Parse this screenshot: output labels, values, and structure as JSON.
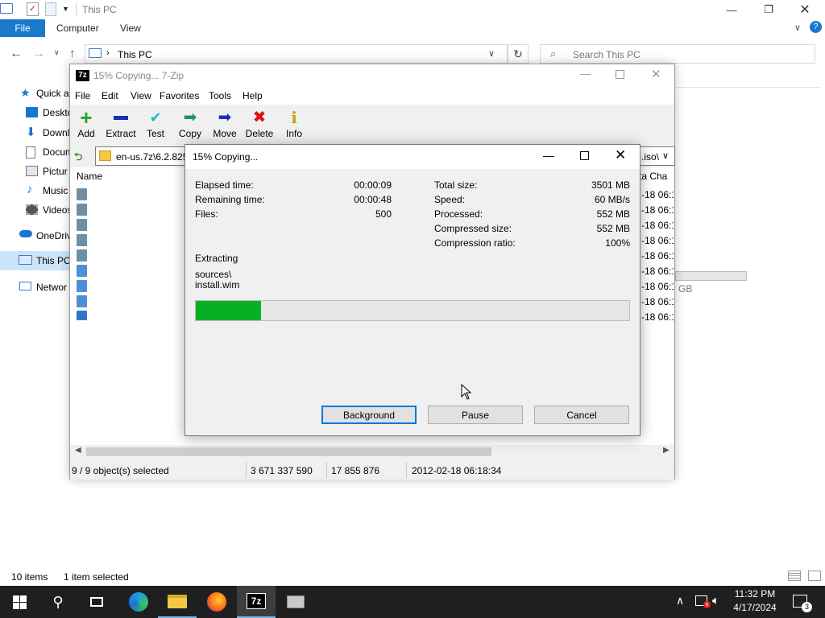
{
  "explorer": {
    "title": "This PC",
    "ribbon": {
      "file": "File",
      "tabs": [
        "Computer",
        "View"
      ]
    },
    "address": "This PC",
    "search_placeholder": "Search This PC",
    "nav": [
      {
        "label": "Quick a"
      },
      {
        "label": "Deskto"
      },
      {
        "label": "Downl"
      },
      {
        "label": "Docum"
      },
      {
        "label": "Pictur"
      },
      {
        "label": "Music"
      },
      {
        "label": "Videos"
      },
      {
        "label": "OneDriv"
      },
      {
        "label": "This PC"
      },
      {
        "label": "Networ"
      }
    ],
    "right_frag": "GB",
    "status_items": "10 items",
    "status_selected": "1 item selected"
  },
  "zip": {
    "title": "15% Copying... 7-Zip",
    "menu": [
      "File",
      "Edit",
      "View",
      "Favorites",
      "Tools",
      "Help"
    ],
    "toolbar": [
      "Add",
      "Extract",
      "Test",
      "Copy",
      "Move",
      "Delete",
      "Info"
    ],
    "path": "en-us.7z\\6.2.825",
    "path_right": ".iso\\",
    "col_name": "Name",
    "col_right": "ta Cha",
    "dates": [
      "-18 06:1",
      "-18 06:1",
      "-18 06:1",
      "-18 06:1",
      "-18 06:1",
      "-18 06:1",
      "-18 06:1",
      "-18 06:1",
      "-18 06:1"
    ],
    "status": {
      "selected": "9 / 9 object(s) selected",
      "size": "3 671 337 590",
      "packed": "17 855 876",
      "date": "2012-02-18 06:18:34"
    }
  },
  "dialog": {
    "title": "15% Copying...",
    "elapsed_label": "Elapsed time:",
    "elapsed": "00:00:09",
    "remaining_label": "Remaining time:",
    "remaining": "00:00:48",
    "files_label": "Files:",
    "files": "500",
    "total_label": "Total size:",
    "total": "3501 MB",
    "speed_label": "Speed:",
    "speed": "60 MB/s",
    "processed_label": "Processed:",
    "processed": "552 MB",
    "compressed_label": "Compressed size:",
    "compressed": "552 MB",
    "ratio_label": "Compression ratio:",
    "ratio": "100%",
    "action": "Extracting",
    "file_path": "sources\\",
    "file_name": "install.wim",
    "progress": 0.15,
    "buttons": {
      "background": "Background",
      "pause": "Pause",
      "cancel": "Cancel"
    }
  },
  "taskbar": {
    "time": "11:32 PM",
    "date": "4/17/2024",
    "notif_count": "3"
  },
  "colors": {
    "accent": "#1979ca",
    "progress": "#06b025",
    "taskbar": "#1f1f1f"
  }
}
